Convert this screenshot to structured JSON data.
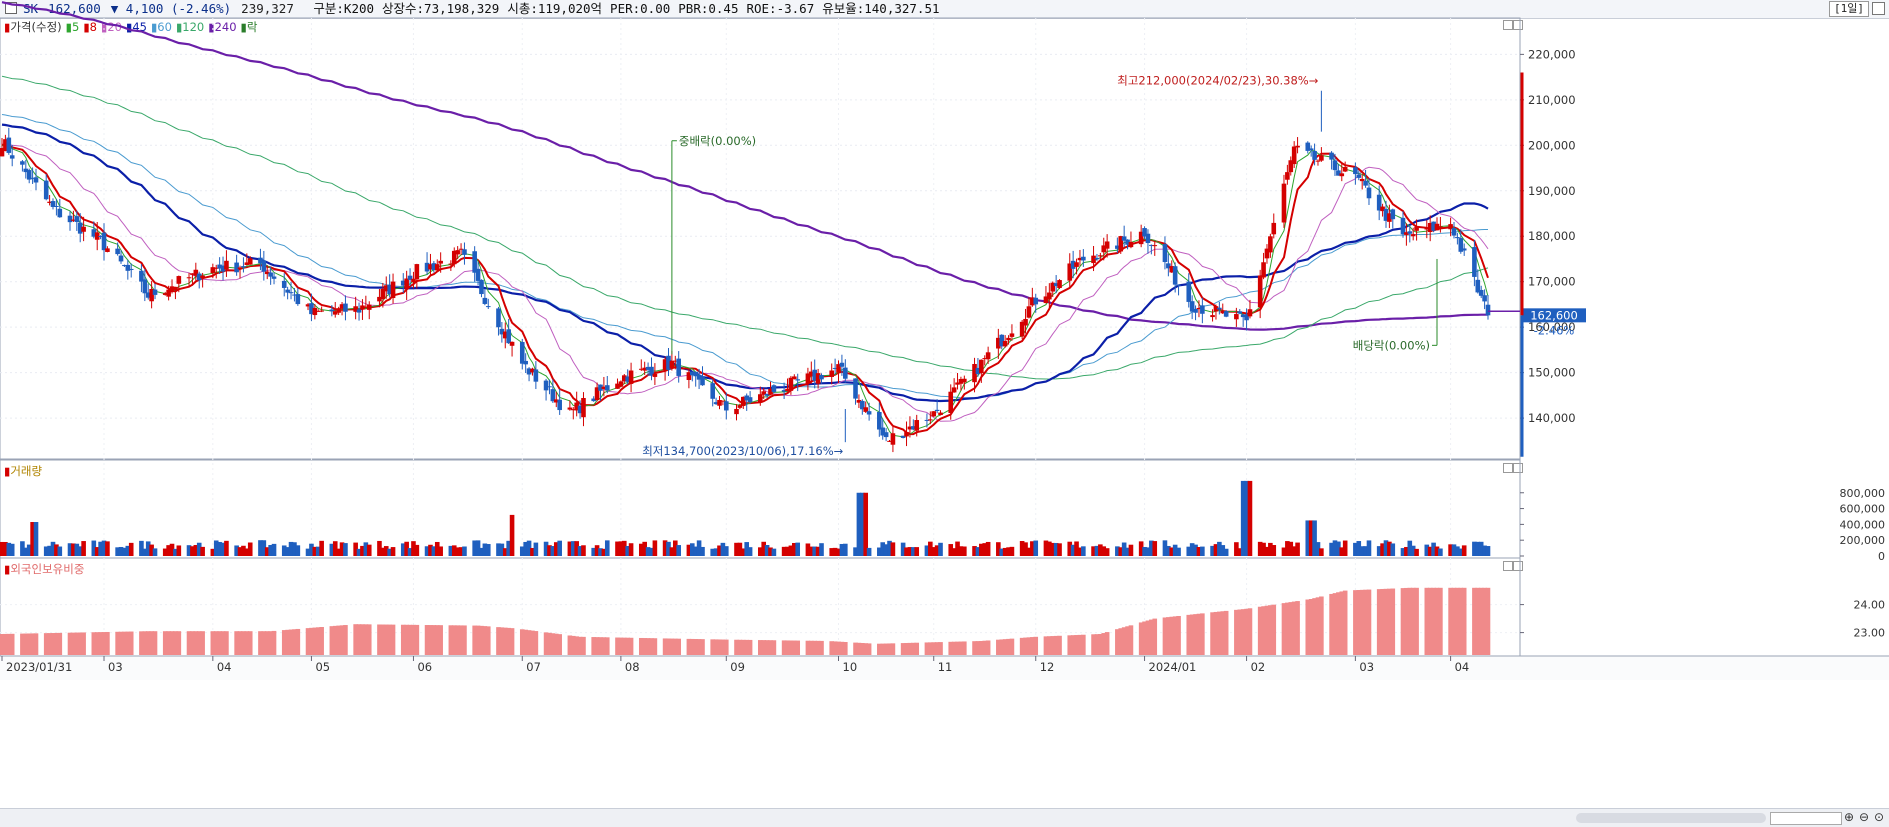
{
  "header": {
    "symbol": "SK",
    "price": "162,600",
    "change": "▼ 4,100 (-2.46%)",
    "volume": "239,327",
    "fields": [
      "구분:K200",
      "상장수:73,198,329",
      "시총:119,020억",
      "PER:0.00",
      "PBR:0.45",
      "ROE:-3.67",
      "유보율:140,327.51"
    ],
    "period": "[1일]"
  },
  "legend": {
    "items": [
      {
        "label": "가격(수정)",
        "color": "#d40000"
      },
      {
        "label": "5",
        "color": "#2ea52e"
      },
      {
        "label": "8",
        "color": "#d40000"
      },
      {
        "label": "20",
        "color": "#c060c0"
      },
      {
        "label": "45",
        "color": "#0b1fa8"
      },
      {
        "label": "60",
        "color": "#4a9bd0"
      },
      {
        "label": "120",
        "color": "#3aa86a"
      },
      {
        "label": "240",
        "color": "#6a1fa8"
      },
      {
        "label": "락",
        "color": "#2a7d2a"
      }
    ],
    "volume_label": "거래량",
    "foreign_label": "외국인보유비중"
  },
  "colors": {
    "up": "#d40000",
    "down": "#1f5fbf",
    "ma5": "#2ea52e",
    "ma8": "#d40000",
    "ma20": "#c060c0",
    "ma45": "#0b1fa8",
    "ma60": "#4a9bd0",
    "ma120": "#3aa86a",
    "ma240": "#6a1fa8",
    "foreign": "#f08a8a"
  },
  "annotations": {
    "high": "최고212,000(2024/02/23),30.38%",
    "low": "최저134,700(2023/10/06),17.16%",
    "split": "중배락(0.00%)",
    "dividend": "배당락(0.00%)",
    "current_price": "162,600",
    "current_change": "-2.46%"
  },
  "chart_data": [
    {
      "type": "candlestick",
      "title": "가격(수정)",
      "x": [
        "2023-01-31",
        "2023-02-15",
        "2023-03-01",
        "2023-03-15",
        "2023-04-03",
        "2023-04-17",
        "2023-05-02",
        "2023-05-16",
        "2023-06-01",
        "2023-06-15",
        "2023-07-03",
        "2023-07-17",
        "2023-08-01",
        "2023-08-16",
        "2023-09-01",
        "2023-09-15",
        "2023-10-04",
        "2023-10-18",
        "2023-11-01",
        "2023-11-15",
        "2023-12-01",
        "2023-12-15",
        "2024-01-02",
        "2024-01-16",
        "2024-02-01",
        "2024-02-15",
        "2024-03-04",
        "2024-03-18",
        "2024-04-01",
        "2024-04-12"
      ],
      "close": [
        201000,
        186000,
        179000,
        167000,
        173000,
        174000,
        163000,
        164000,
        172000,
        176000,
        152000,
        141000,
        149000,
        152000,
        142000,
        146000,
        151000,
        135000,
        141000,
        152000,
        166000,
        175000,
        181000,
        165000,
        161000,
        199000,
        193000,
        180000,
        183000,
        162600
      ],
      "y_ticks": [
        140000,
        150000,
        160000,
        170000,
        180000,
        190000,
        200000,
        210000,
        220000
      ],
      "y_tick_labels": [
        "140,000",
        "150,000",
        "160,000",
        "170,000",
        "180,000",
        "190,000",
        "200,000",
        "210,000",
        "220,000"
      ],
      "ylim": [
        131000,
        228000
      ],
      "x_tick_labels": [
        "2023/01/31",
        "03",
        "04",
        "05",
        "06",
        "07",
        "08",
        "09",
        "10",
        "11",
        "12",
        "2024/01",
        "02",
        "03",
        "04"
      ],
      "high": {
        "value": 212000,
        "date": "2024-02-23"
      },
      "low": {
        "value": 134700,
        "date": "2023-10-06"
      }
    },
    {
      "type": "bar",
      "title": "거래량",
      "y_ticks": [
        0,
        200000,
        400000,
        600000,
        800000
      ],
      "y_tick_labels": [
        "0",
        "200,000",
        "400,000",
        "600,000",
        "800,000"
      ],
      "ylim": [
        0,
        1050000
      ],
      "spikes": [
        {
          "date": "2023-02-10",
          "value": 430000
        },
        {
          "date": "2023-07-01",
          "value": 520000
        },
        {
          "date": "2023-10-11",
          "value": 800000
        },
        {
          "date": "2024-02-01",
          "value": 950000
        },
        {
          "date": "2024-02-20",
          "value": 450000
        }
      ]
    },
    {
      "type": "area",
      "title": "외국인보유비중",
      "y_ticks": [
        23.0,
        24.0
      ],
      "y_tick_labels": [
        "23.00",
        "24.00"
      ],
      "ylim": [
        22.2,
        25.2
      ],
      "x": [
        "2023-01-31",
        "2023-03-15",
        "2023-04-20",
        "2023-05-15",
        "2023-06-20",
        "2023-07-01",
        "2023-07-20",
        "2023-09-01",
        "2023-10-01",
        "2023-10-15",
        "2023-11-15",
        "2023-12-01",
        "2023-12-20",
        "2024-01-05",
        "2024-01-20",
        "2024-02-01",
        "2024-02-20",
        "2024-03-01",
        "2024-03-20",
        "2024-04-12"
      ],
      "values": [
        22.95,
        23.05,
        23.05,
        23.3,
        23.25,
        23.15,
        22.85,
        22.75,
        22.7,
        22.6,
        22.7,
        22.85,
        22.95,
        23.5,
        23.7,
        23.85,
        24.2,
        24.5,
        24.6,
        24.6
      ]
    }
  ]
}
